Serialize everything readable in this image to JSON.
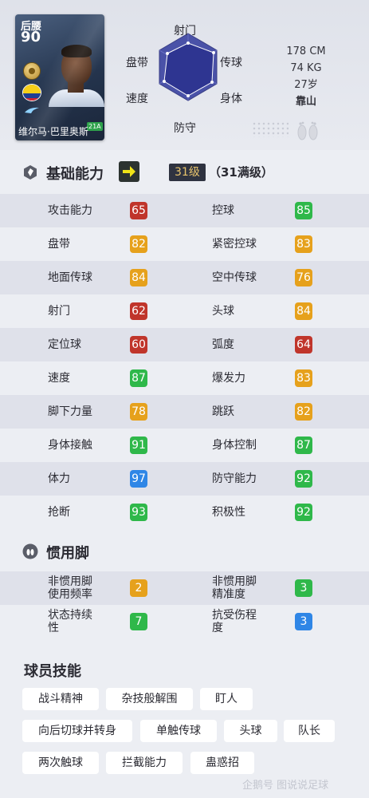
{
  "player": {
    "position": "后腰",
    "overall": "90",
    "name": "维尔马·巴里奥斯",
    "card_badge": "21A",
    "height": "178 CM",
    "weight": "74 KG",
    "age": "27岁",
    "foot": "靠山"
  },
  "radar": {
    "top": "射门",
    "upper_left": "盘带",
    "upper_right": "传球",
    "lower_left": "速度",
    "lower_right": "身体",
    "bottom": "防守"
  },
  "basic": {
    "title": "基础能力",
    "level_pill": "31级",
    "level_text": "（31满级）",
    "rows": [
      {
        "l_label": "攻击能力",
        "l_value": "65",
        "l_color": "#c0352b",
        "r_label": "控球",
        "r_value": "85",
        "r_color": "#2fb84a"
      },
      {
        "l_label": "盘带",
        "l_value": "82",
        "l_color": "#e6a11c",
        "r_label": "紧密控球",
        "r_value": "83",
        "r_color": "#e6a11c"
      },
      {
        "l_label": "地面传球",
        "l_value": "84",
        "l_color": "#e6a11c",
        "r_label": "空中传球",
        "r_value": "76",
        "r_color": "#e6a11c"
      },
      {
        "l_label": "射门",
        "l_value": "62",
        "l_color": "#c0352b",
        "r_label": "头球",
        "r_value": "84",
        "r_color": "#e6a11c"
      },
      {
        "l_label": "定位球",
        "l_value": "60",
        "l_color": "#c0352b",
        "r_label": "弧度",
        "r_value": "64",
        "r_color": "#c0352b"
      },
      {
        "l_label": "速度",
        "l_value": "87",
        "l_color": "#2fb84a",
        "r_label": "爆发力",
        "r_value": "83",
        "r_color": "#e6a11c"
      },
      {
        "l_label": "脚下力量",
        "l_value": "78",
        "l_color": "#e6a11c",
        "r_label": "跳跃",
        "r_value": "82",
        "r_color": "#e6a11c"
      },
      {
        "l_label": "身体接触",
        "l_value": "91",
        "l_color": "#2fb84a",
        "r_label": "身体控制",
        "r_value": "87",
        "r_color": "#2fb84a"
      },
      {
        "l_label": "体力",
        "l_value": "97",
        "l_color": "#2f86e6",
        "r_label": "防守能力",
        "r_value": "92",
        "r_color": "#2fb84a"
      },
      {
        "l_label": "抢断",
        "l_value": "93",
        "l_color": "#2fb84a",
        "r_label": "积极性",
        "r_value": "92",
        "r_color": "#2fb84a"
      }
    ]
  },
  "foot": {
    "title": "惯用脚",
    "rows": [
      {
        "l_label1": "非惯用脚",
        "l_label2": "使用频率",
        "l_value": "2",
        "l_color": "#e6a11c",
        "r_label1": "非惯用脚",
        "r_label2": "精准度",
        "r_value": "3",
        "r_color": "#2fb84a"
      },
      {
        "l_label1": "状态持续",
        "l_label2": "性",
        "l_value": "7",
        "l_color": "#2fb84a",
        "r_label1": "抗受伤程",
        "r_label2": "度",
        "r_value": "3",
        "r_color": "#2f86e6"
      }
    ]
  },
  "skills": {
    "title": "球员技能",
    "items": [
      "战斗精神",
      "杂技般解围",
      "盯人",
      "向后切球并转身",
      "单触传球",
      "头球",
      "队长",
      "两次触球",
      "拦截能力",
      "蛊惑招"
    ]
  },
  "watermark": "企鹅号 图说说足球"
}
